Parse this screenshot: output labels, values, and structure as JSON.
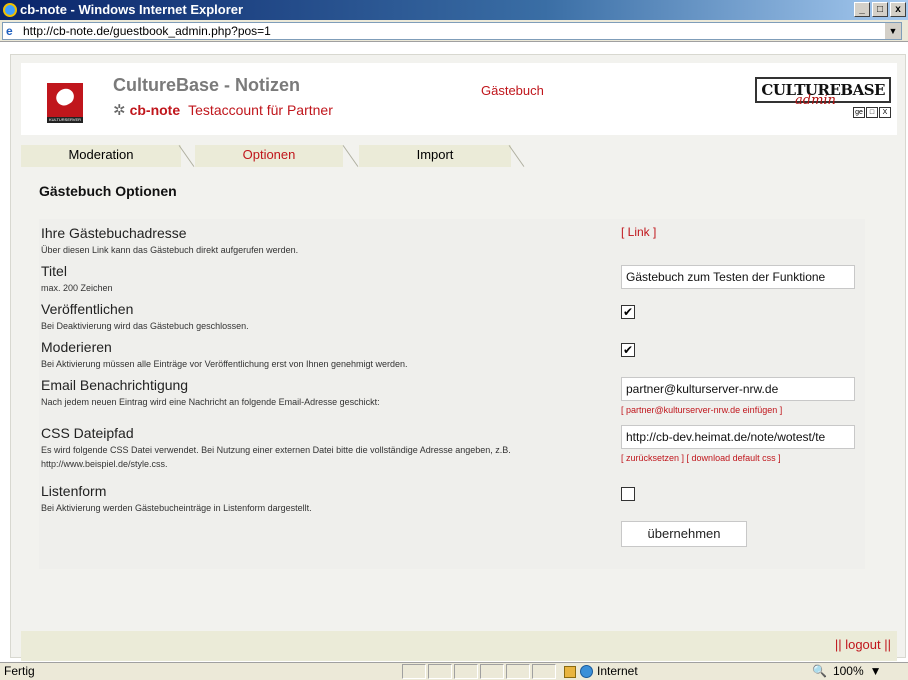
{
  "window": {
    "title": "cb-note - Windows Internet Explorer",
    "minimize": "_",
    "maximize": "□",
    "close": "x"
  },
  "address": {
    "url": "http://cb-note.de/guestbook_admin.php?pos=1",
    "dropdown": "▼"
  },
  "header": {
    "brand_title": "CultureBase - Notizen",
    "brand_logo_strip": "KULTURSERVER",
    "account": "cb-note",
    "account_desc": "Testaccount für Partner",
    "section": "Gästebuch",
    "cb_logo_text": "CULTUREBASE",
    "cb_logo_admin": "admin",
    "cb_logo_icons": [
      "ge",
      "□",
      "X"
    ]
  },
  "tabs": [
    {
      "label": "Moderation",
      "active": false
    },
    {
      "label": "Optionen",
      "active": true
    },
    {
      "label": "Import",
      "active": false
    }
  ],
  "content_title": "Gästebuch Optionen",
  "options": {
    "address": {
      "label": "Ihre Gästebuchadresse",
      "desc": "Über diesen Link kann das Gästebuch direkt aufgerufen werden.",
      "link": "[ Link ]"
    },
    "title": {
      "label": "Titel",
      "desc": "max. 200 Zeichen",
      "value": "Gästebuch zum Testen der Funktione"
    },
    "publish": {
      "label": "Veröffentlichen",
      "desc": "Bei Deaktivierung wird das Gästebuch geschlossen.",
      "checked": true
    },
    "moderate": {
      "label": "Moderieren",
      "desc": "Bei Aktivierung müssen alle Einträge vor Veröffentlichung erst von Ihnen genehmigt werden.",
      "checked": true
    },
    "email": {
      "label": "Email Benachrichtigung",
      "desc": "Nach jedem neuen Eintrag wird eine Nachricht an folgende Email-Adresse geschickt:",
      "value": "partner@kulturserver-nrw.de",
      "insert_link": "[ partner@kulturserver-nrw.de einfügen ]"
    },
    "css": {
      "label": "CSS Dateipfad",
      "desc": "Es wird folgende CSS Datei verwendet. Bei Nutzung einer externen Datei bitte die vollständige Adresse angeben, z.B. http://www.beispiel.de/style.css.",
      "value": "http://cb-dev.heimat.de/note/wotest/te",
      "reset_link": "[ zurücksetzen ]",
      "download_link": "[ download default css ]"
    },
    "list": {
      "label": "Listenform",
      "desc": "Bei Aktivierung werden Gästebucheinträge in Listenform dargestellt.",
      "checked": false
    },
    "submit_label": "übernehmen"
  },
  "footer": {
    "logout": "|| logout ||"
  },
  "status": {
    "text": "Fertig",
    "zone": "Internet",
    "zoom": "100%",
    "zoom_arrow": "▼"
  },
  "icons": {
    "check_mark": "✔",
    "flower": "✲",
    "zoom": "🔍"
  }
}
